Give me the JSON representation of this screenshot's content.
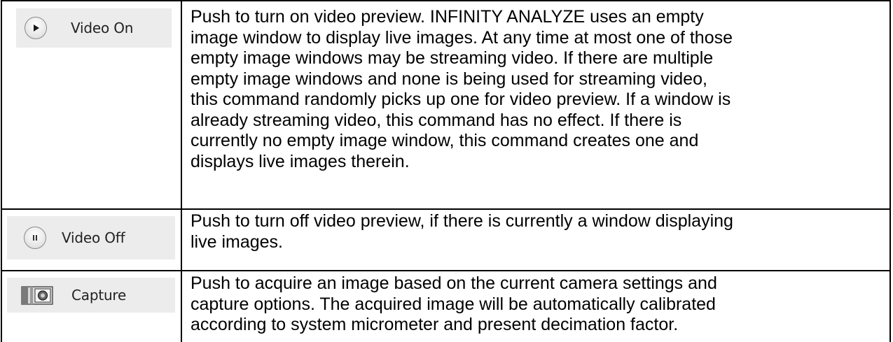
{
  "rows": [
    {
      "button": {
        "label": "Video On",
        "icon": "play-icon"
      },
      "description": [
        "Push to turn on video preview. INFINITY ANALYZE uses an empty",
        "image window to display live images. At any time at most one of those",
        "empty image windows may be streaming video. If there are multiple",
        "empty image windows and none is being used for streaming video,",
        "this command randomly picks up one for video preview. If a window is",
        "already streaming video, this command has no effect. If there is",
        "currently no empty image window, this command creates one and",
        "displays live images therein."
      ]
    },
    {
      "button": {
        "label": "Video Off",
        "icon": "pause-icon"
      },
      "description": [
        "Push to turn off video preview, if there is currently a window displaying",
        "live images."
      ]
    },
    {
      "button": {
        "label": "Capture",
        "icon": "camera-icon"
      },
      "description": [
        "Push to acquire an image based on the current camera settings and",
        "capture options. The acquired image will be automatically calibrated",
        "according to system micrometer and present decimation factor."
      ]
    }
  ]
}
